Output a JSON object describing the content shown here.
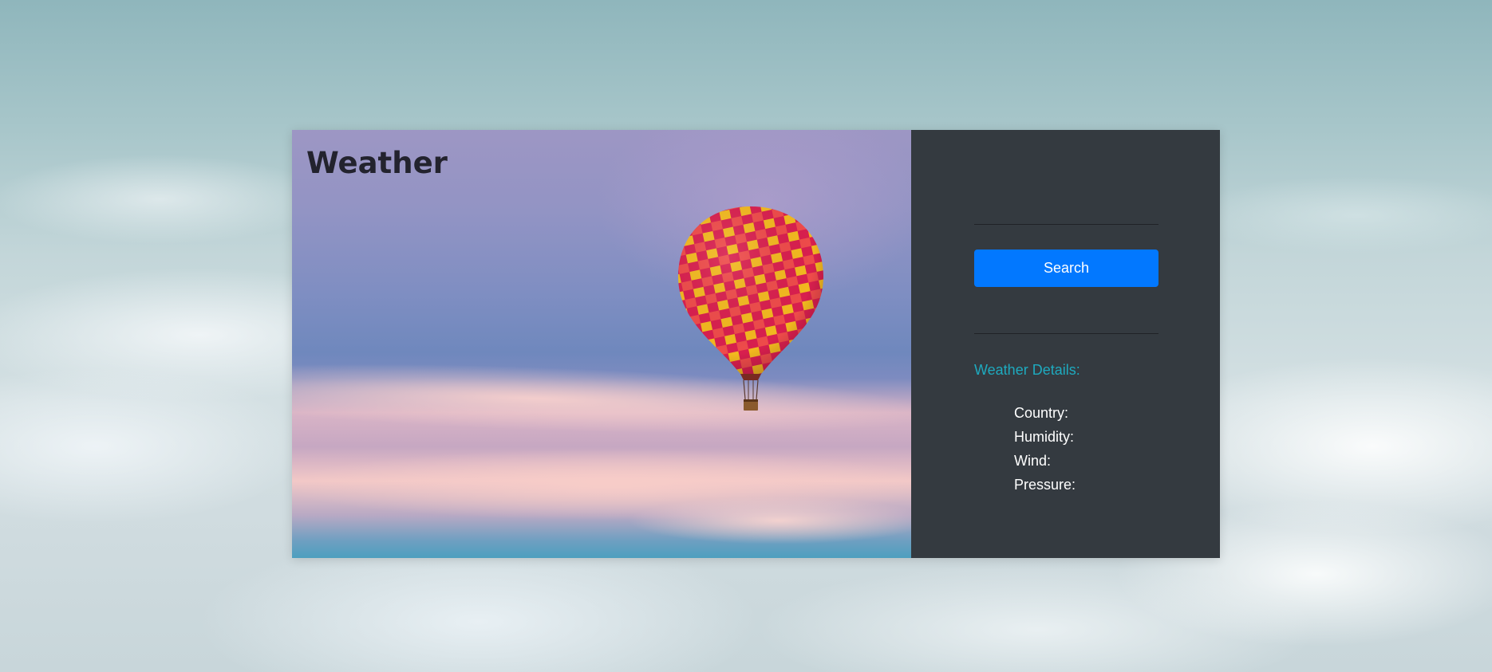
{
  "app": {
    "title": "Weather"
  },
  "search": {
    "input_value": "",
    "placeholder": "",
    "button_label": "Search"
  },
  "details": {
    "heading": "Weather Details:",
    "items": [
      {
        "label": "Country:"
      },
      {
        "label": "Humidity:"
      },
      {
        "label": "Wind:"
      },
      {
        "label": "Pressure:"
      }
    ]
  },
  "colors": {
    "panel_bg": "#343a40",
    "button_bg": "#0278ff",
    "heading_accent": "#1eaabf",
    "title_text": "#23232e"
  },
  "images": {
    "hero": "hot-air-balloon-icon",
    "background": "clouds-background"
  }
}
